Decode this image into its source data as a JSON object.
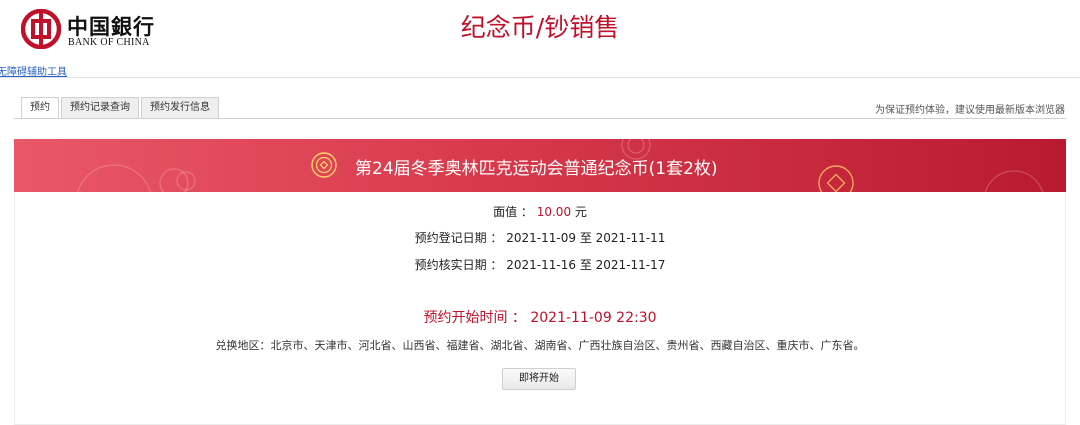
{
  "header": {
    "logo_cn": "中国銀行",
    "logo_en": "BANK OF CHINA",
    "page_title": "纪念币/钞销售"
  },
  "a11y_link": "无障碍辅助工具",
  "tabs": [
    {
      "label": "预约",
      "active": true
    },
    {
      "label": "预约记录查询",
      "active": false
    },
    {
      "label": "预约发行信息",
      "active": false
    }
  ],
  "browser_tip": "为保证预约体验，建议使用最新版本浏览器",
  "product": {
    "title": "第24届冬季奥林匹克运动会普通纪念币(1套2枚)",
    "face_value_label": "面值 ：",
    "face_value": "10.00",
    "face_value_unit": "元",
    "reg_label": "预约登记日期 ：",
    "reg_start": "2021-11-09",
    "reg_sep": "至",
    "reg_end": "2021-11-11",
    "verify_label": "预约核实日期 ：",
    "verify_start": "2021-11-16",
    "verify_sep": "至",
    "verify_end": "2021-11-17",
    "start_time_label": "预约开始时间 ：",
    "start_time": "2021-11-09 22:30",
    "regions": "兑换地区：北京市、天津市、河北省、山西省、福建省、湖北省、湖南省、广西壮族自治区、贵州省、西藏自治区、重庆市、广东省。",
    "button_label": "即将开始"
  },
  "colors": {
    "brand_red": "#c0102a",
    "banner_start": "#e95867",
    "banner_end": "#b91a30",
    "link_blue": "#2a62c6"
  }
}
